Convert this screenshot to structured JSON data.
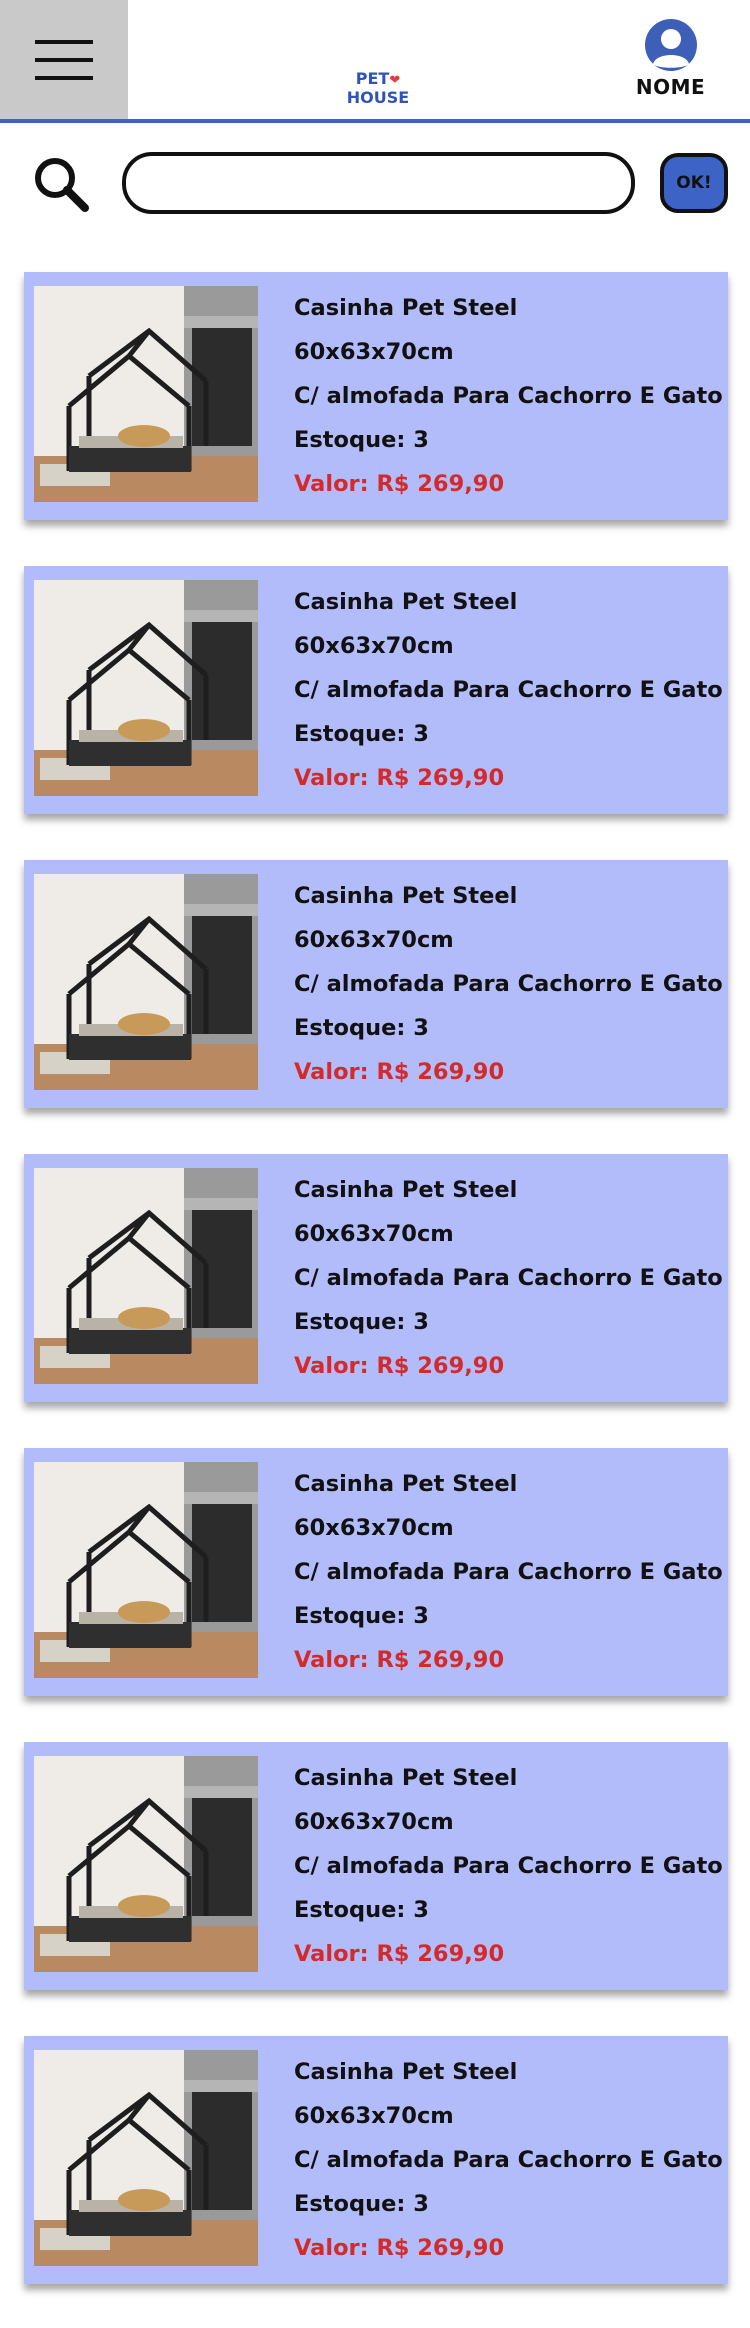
{
  "header": {
    "menu_icon": "hamburger-menu-icon",
    "logo": {
      "line1": "PET",
      "line2": "HOUSE",
      "mark": "paw-icon"
    },
    "user": {
      "name": "NOME",
      "icon": "user-avatar-icon"
    },
    "colors": {
      "accent": "#3d63c6",
      "menu_bg": "#c9c9c9"
    }
  },
  "search": {
    "icon": "search-icon",
    "placeholder": "",
    "value": "",
    "button_label": "OK!"
  },
  "products": [
    {
      "title": "Casinha Pet Steel",
      "size": "60x63x70cm",
      "desc": "C/ almofada Para Cachorro E Gato",
      "stock": "Estoque: 3",
      "price": "Valor: R$ 269,90",
      "image": "pet-house-image"
    },
    {
      "title": "Casinha Pet Steel",
      "size": "60x63x70cm",
      "desc": "C/ almofada Para Cachorro E Gato",
      "stock": "Estoque: 3",
      "price": "Valor: R$ 269,90",
      "image": "pet-house-image"
    },
    {
      "title": "Casinha Pet Steel",
      "size": "60x63x70cm",
      "desc": "C/ almofada Para Cachorro E Gato",
      "stock": "Estoque: 3",
      "price": "Valor: R$ 269,90",
      "image": "pet-house-image"
    },
    {
      "title": "Casinha Pet Steel",
      "size": "60x63x70cm",
      "desc": "C/ almofada Para Cachorro E Gato",
      "stock": "Estoque: 3",
      "price": "Valor: R$ 269,90",
      "image": "pet-house-image"
    },
    {
      "title": "Casinha Pet Steel",
      "size": "60x63x70cm",
      "desc": "C/ almofada Para Cachorro E Gato",
      "stock": "Estoque: 3",
      "price": "Valor: R$ 269,90",
      "image": "pet-house-image"
    },
    {
      "title": "Casinha Pet Steel",
      "size": "60x63x70cm",
      "desc": "C/ almofada Para Cachorro E Gato",
      "stock": "Estoque: 3",
      "price": "Valor: R$ 269,90",
      "image": "pet-house-image"
    },
    {
      "title": "Casinha Pet Steel",
      "size": "60x63x70cm",
      "desc": "C/ almofada Para Cachorro E Gato",
      "stock": "Estoque: 3",
      "price": "Valor: R$ 269,90",
      "image": "pet-house-image"
    }
  ],
  "card_colors": {
    "background": "#b3bcfb",
    "price": "#d22b2b"
  }
}
